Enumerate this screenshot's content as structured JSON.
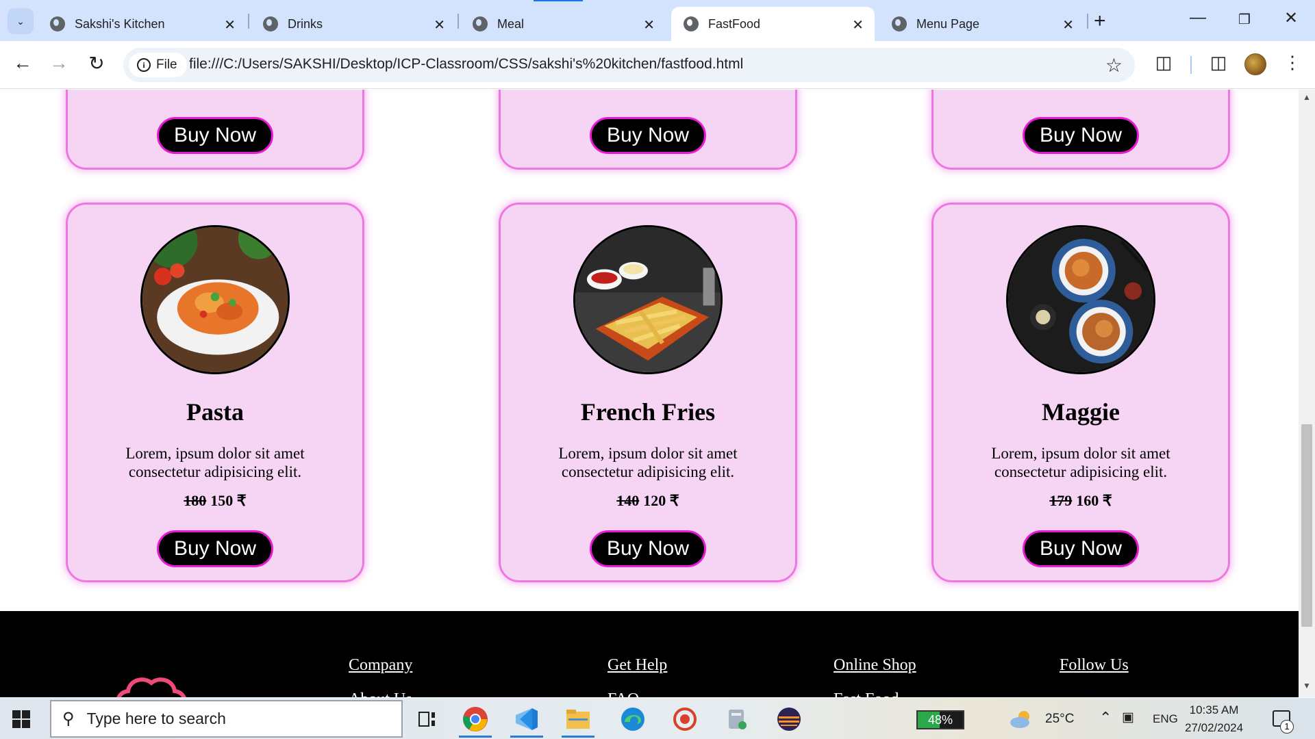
{
  "browser": {
    "tabs": [
      {
        "label": "Sakshi's Kitchen",
        "active": false
      },
      {
        "label": "Drinks",
        "active": false
      },
      {
        "label": "Meal",
        "active": false
      },
      {
        "label": "FastFood",
        "active": true
      },
      {
        "label": "Menu Page",
        "active": false
      }
    ],
    "address_chip": "File",
    "url": "file:///C:/Users/SAKSHI/Desktop/ICP-Classroom/CSS/sakshi's%20kitchen/fastfood.html"
  },
  "page": {
    "partial_cards": [
      {
        "button_label": "Buy Now"
      },
      {
        "button_label": "Buy Now"
      },
      {
        "button_label": "Buy Now"
      }
    ],
    "cards": [
      {
        "title": "Pasta",
        "description": "Lorem, ipsum dolor sit amet consectetur adipisicing elit.",
        "old_price": "180",
        "new_price": "150 ₹",
        "button_label": "Buy Now",
        "image": "pasta-image"
      },
      {
        "title": "French Fries",
        "description": "Lorem, ipsum dolor sit amet consectetur adipisicing elit.",
        "old_price": "140",
        "new_price": "120 ₹",
        "button_label": "Buy Now",
        "image": "french-fries-image"
      },
      {
        "title": "Maggie",
        "description": "Lorem, ipsum dolor sit amet consectetur adipisicing elit.",
        "old_price": "179",
        "new_price": "160 ₹",
        "button_label": "Buy Now",
        "image": "maggie-image"
      }
    ],
    "accent_colors": {
      "card_bg": "#f5d5f3",
      "card_border": "#ee77e0",
      "button_border": "#e81ad6",
      "footer_bg": "#000000"
    },
    "footer": {
      "columns": [
        {
          "heading": "Company",
          "first_item": "About Us"
        },
        {
          "heading": "Get Help",
          "first_item": "FAQ"
        },
        {
          "heading": "Online Shop",
          "first_item": "Fast Food"
        },
        {
          "heading": "Follow Us",
          "first_item": ""
        }
      ]
    }
  },
  "taskbar": {
    "search_placeholder": "Type here to search",
    "battery": "48%",
    "battery_level": 0.48,
    "temperature": "25°C",
    "language": "ENG",
    "time": "10:35 AM",
    "date": "27/02/2024",
    "notification_count": "1"
  }
}
